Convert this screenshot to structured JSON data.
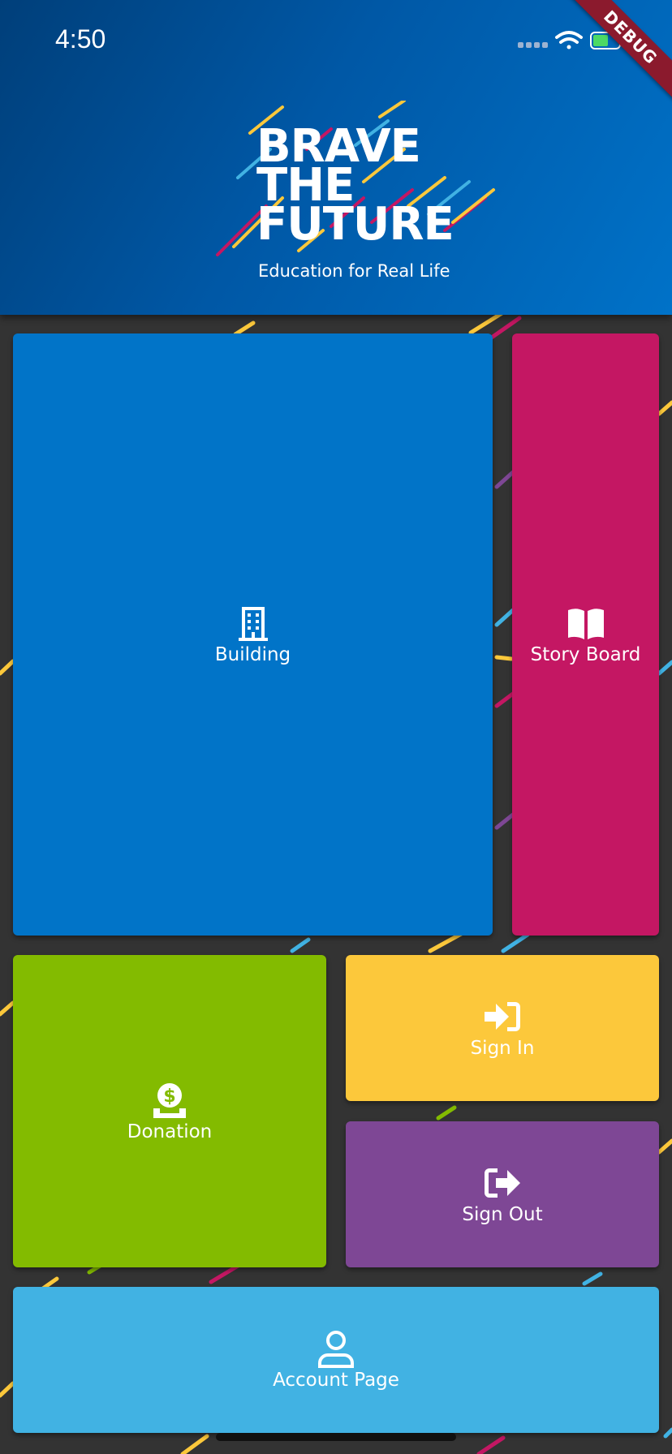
{
  "status_bar": {
    "time": "4:50",
    "debug_label": "DEBUG"
  },
  "logo": {
    "line1": "BRAVE",
    "line2": "THE",
    "line3": "FUTURE",
    "tagline": "Education for Real Life"
  },
  "tiles": {
    "building": {
      "label": "Building",
      "icon": "building-icon",
      "color": "#0174c8"
    },
    "story_board": {
      "label": "Story Board",
      "icon": "book-open-icon",
      "color": "#c41763"
    },
    "donation": {
      "label": "Donation",
      "icon": "donate-icon",
      "color": "#83bb00"
    },
    "sign_in": {
      "label": "Sign In",
      "icon": "sign-in-icon",
      "color": "#fcc83b"
    },
    "sign_out": {
      "label": "Sign Out",
      "icon": "sign-out-icon",
      "color": "#7e4795"
    },
    "account_page": {
      "label": "Account Page",
      "icon": "user-icon",
      "color": "#41b2e3"
    }
  }
}
